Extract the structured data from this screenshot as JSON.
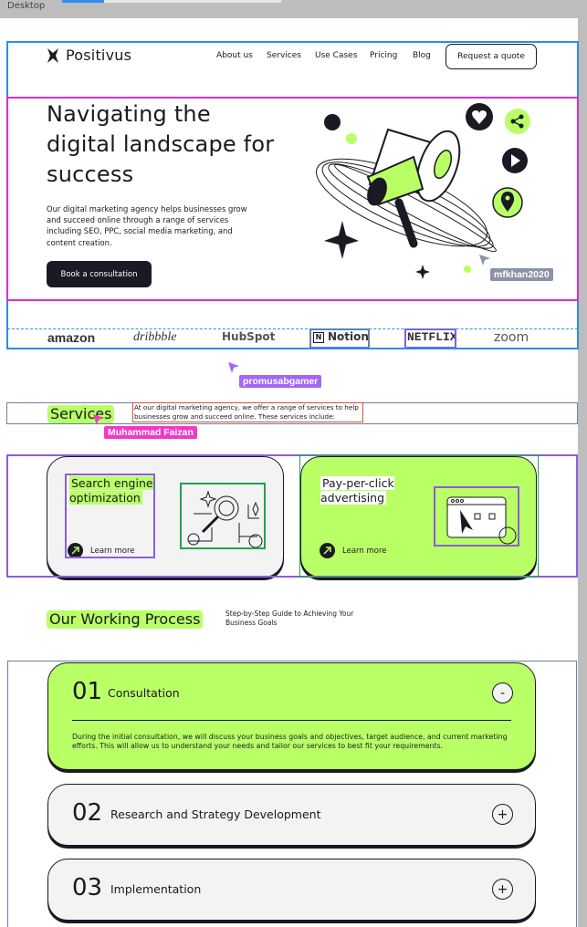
{
  "canvas": {
    "label": "Desktop"
  },
  "navbar": {
    "logo": "Positivus",
    "links": [
      "About us",
      "Services",
      "Use Cases",
      "Pricing",
      "Blog"
    ],
    "cta": "Request a quote"
  },
  "hero": {
    "title": "Navigating the digital landscape for success",
    "description": "Our digital marketing agency helps businesses grow and succeed online through a range of services including SEO, PPC, social media marketing, and content creation.",
    "button": "Book a consultation"
  },
  "collaborators": [
    {
      "name": "mfkhan2020",
      "color": "#8b93a8"
    },
    {
      "name": "promusabgamer",
      "color": "#a565f5"
    },
    {
      "name": "Muhammad Faizan",
      "color": "#f03ac6"
    }
  ],
  "brands": [
    "amazon",
    "dribbble",
    "HubSpot",
    "Notion",
    "NETFLIX",
    "zoom"
  ],
  "services": {
    "title": "Services",
    "description": "At our digital marketing agency, we offer a range of services to help businesses grow and succeed online. These services include:",
    "cards": [
      {
        "title": "Search engine optimization",
        "link": "Learn more"
      },
      {
        "title": "Pay-per-click advertising",
        "link": "Learn more"
      }
    ]
  },
  "process": {
    "title": "Our Working Process",
    "subtitle": "Step-by-Step Guide to Achieving Your Business Goals",
    "steps": [
      {
        "number": "01",
        "title": "Consultation",
        "toggle": "-",
        "body": "During the initial consultation, we will discuss your business goals and objectives, target audience, and current marketing efforts. This will allow us to understand your needs and tailor our services to best fit your requirements."
      },
      {
        "number": "02",
        "title": "Research and Strategy Development",
        "toggle": "+"
      },
      {
        "number": "03",
        "title": "Implementation",
        "toggle": "+"
      }
    ]
  },
  "colors": {
    "accent": "#b9ff66",
    "dark": "#191a23",
    "grey": "#f3f3f3",
    "selection_blue": "#2d8cf0",
    "selection_magenta": "#e02bd0",
    "selection_purple": "#8b5fd6",
    "selection_green": "#22a34a",
    "selection_red": "#d9502f",
    "selection_slate": "#6a7fa8"
  }
}
